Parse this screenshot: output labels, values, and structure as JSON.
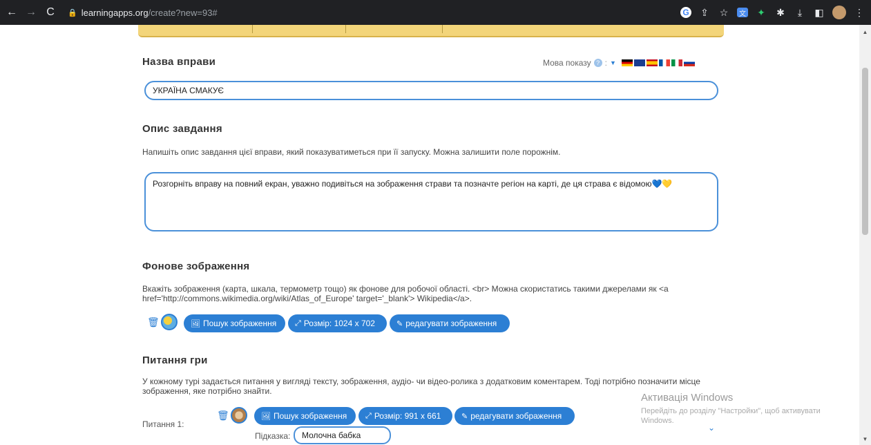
{
  "browser": {
    "url_host": "learningapps.org",
    "url_path": "/create?new=93#"
  },
  "exercise_name": {
    "heading": "Назва вправи",
    "value": "УКРАЇНА СМАКУЄ",
    "display_language_label": "Мова показу"
  },
  "task_description": {
    "heading": "Опис завдання",
    "hint": "Напишіть опис завдання цієї вправи, який показуватиметься при її запуску. Можна залишити поле порожнім.",
    "value": "Розгорніть вправу на повний екран, уважно подивіться на зображення страви та позначте регіон на карті, де ця страва є відомою💙💛"
  },
  "background_image": {
    "heading": "Фонове зображення",
    "hint": "Вкажіть зображення (карта, шкала, термометр тощо) як фонове для робочої області. <br> Можна скористатись такими джерелами як <a href='http://commons.wikimedia.org/wiki/Atlas_of_Europe' target='_blank'> Wikipedia</a>.",
    "search_label": "Пошук зображення",
    "size_label": "Розмір: 1024 x 702",
    "edit_label": "редагувати зображення"
  },
  "game_questions": {
    "heading": "Питання гри",
    "hint": "У кожному турі задається питання у вигляді тексту, зображення, аудіо- чи відео-ролика з додатковим коментарем. Тоді потрібно позначити місце зображення, яке потрібно знайти.",
    "question1_label": "Питання 1:",
    "search_label": "Пошук зображення",
    "size_label": "Розмір: 991 x 661",
    "edit_label": "редагувати зображення",
    "hint_label": "Підказка:",
    "hint_value": "Молочна бабка"
  },
  "watermark": {
    "title": "Активація Windows",
    "text": "Перейдіть до розділу \"Настройки\", щоб активувати Windows."
  },
  "colors": {
    "accent": "#2c7fd4",
    "field_border": "#4a90d9",
    "chrome_bg": "#202124"
  }
}
